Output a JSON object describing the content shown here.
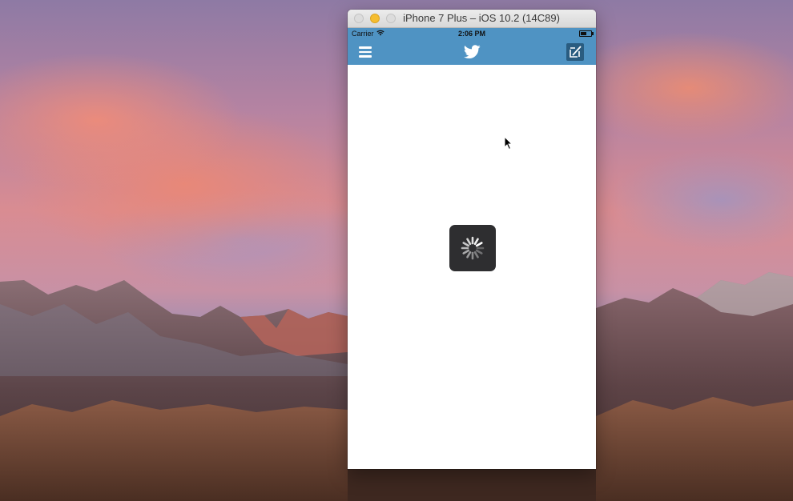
{
  "window": {
    "title": "iPhone 7 Plus – iOS 10.2 (14C89)"
  },
  "status_bar": {
    "carrier": "Carrier",
    "time": "2:06 PM",
    "battery_level": 0.6
  },
  "nav_bar": {
    "menu_icon": "hamburger-menu-icon",
    "logo_icon": "twitter-bird-icon",
    "right_icon": "compose-icon"
  },
  "content": {
    "loading": true,
    "indicator_icon": "activity-spinner-icon"
  },
  "colors": {
    "nav_bar": "#4f93c3",
    "compose_button": "#2a5c80",
    "spinner_box": "#2e2e30",
    "minimize_button": "#f5bd2f"
  }
}
